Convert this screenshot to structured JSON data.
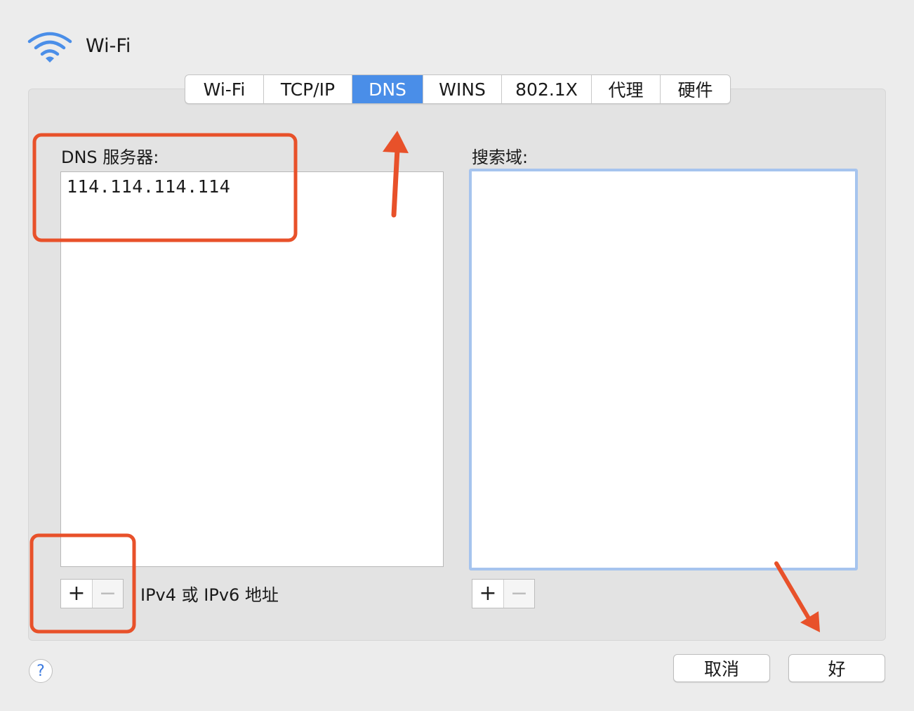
{
  "header": {
    "title": "Wi-Fi",
    "icon": "wifi-icon"
  },
  "tabs": [
    {
      "label": "Wi-Fi"
    },
    {
      "label": "TCP/IP"
    },
    {
      "label": "DNS"
    },
    {
      "label": "WINS"
    },
    {
      "label": "802.1X"
    },
    {
      "label": "代理"
    },
    {
      "label": "硬件"
    }
  ],
  "active_tab": "DNS",
  "dns": {
    "label": "DNS 服务器:",
    "servers": [
      "114.114.114.114"
    ],
    "add_symbol": "+",
    "remove_symbol": "−",
    "hint": "IPv4 或 IPv6 地址"
  },
  "search": {
    "label": "搜索域:",
    "add_symbol": "+",
    "remove_symbol": "−"
  },
  "footer": {
    "help_symbol": "?",
    "cancel_label": "取消",
    "ok_label": "好"
  },
  "colors": {
    "accent": "#4a8ee8",
    "annotation": "#e8512a",
    "focus_ring": "#a6c4ee"
  }
}
